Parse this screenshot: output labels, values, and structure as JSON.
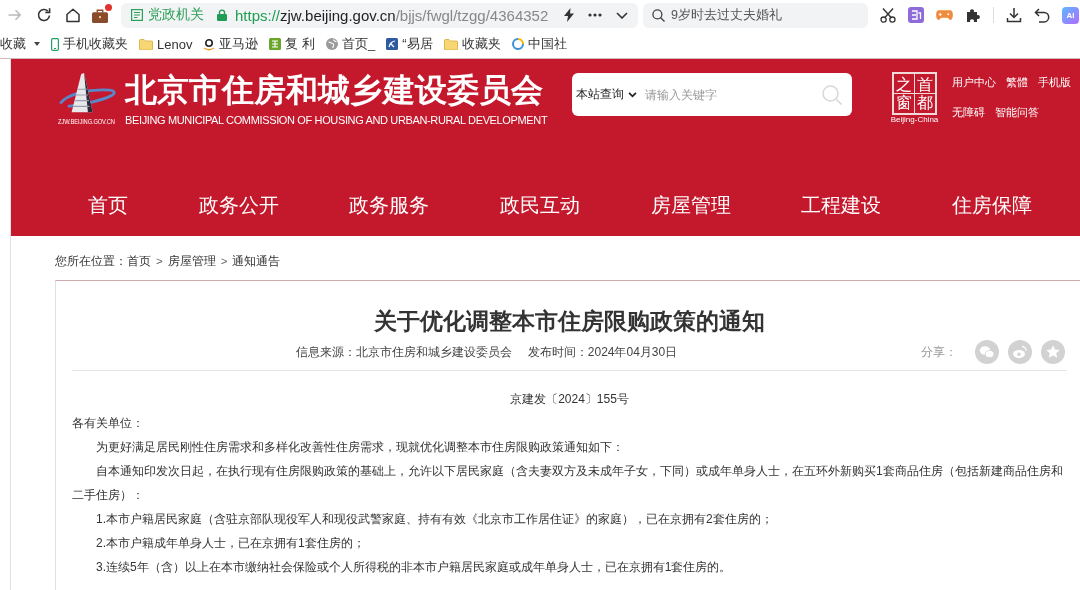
{
  "browser": {
    "nav_buttons": [
      {
        "kind": "forward",
        "disabled": true
      },
      {
        "kind": "reload",
        "disabled": false
      },
      {
        "kind": "home",
        "disabled": false
      }
    ],
    "extension_badge": true,
    "address_bar": {
      "badge": "党政机关",
      "secure": true,
      "url": {
        "scheme": "https://",
        "host": "zjw.beijing.gov.cn",
        "path": "/bjjs/fwgl/tzgg/4364352"
      }
    },
    "search": {
      "placeholder": "9岁时去过丈夫婚礼"
    },
    "ai_label": "AI"
  },
  "bookmarks": [
    {
      "kind": "menu",
      "label": "收藏"
    },
    {
      "kind": "phone",
      "label": "手机收藏夹"
    },
    {
      "kind": "folder",
      "label": "Lenov"
    },
    {
      "kind": "amazon",
      "label": "亚马逊"
    },
    {
      "kind": "green-tile",
      "label": "复 利"
    },
    {
      "kind": "globe",
      "label": "首页_"
    },
    {
      "kind": "blue-tile",
      "label": "“易居"
    },
    {
      "kind": "folder",
      "label": "收藏夹"
    },
    {
      "kind": "ring",
      "label": "中国社"
    }
  ],
  "site": {
    "logo_caption": "ZJW.BEIJING.GOV.CN",
    "title": "北京市住房和城乡建设委员会",
    "subtitle": "BEIJING MUNICIPAL COMMISSION OF HOUSING AND URBAN-RURAL DEVELOPMENT",
    "search": {
      "scope": "本站查询",
      "placeholder": "请输入关键字"
    },
    "capital_logo": {
      "columns": [
        "之窗",
        "首都"
      ],
      "caption": "Beijing-China"
    },
    "user_links": [
      [
        "用户中心",
        "繁體",
        "手机版"
      ],
      [
        "无障碍",
        "智能问答"
      ]
    ],
    "nav": [
      "首页",
      "政务公开",
      "政务服务",
      "政民互动",
      "房屋管理",
      "工程建设",
      "住房保障"
    ]
  },
  "breadcrumb": {
    "label": "您所在位置：",
    "items": [
      {
        "kind": "link",
        "text": "首页"
      },
      {
        "kind": "separator",
        "text": ">"
      },
      {
        "kind": "link",
        "text": "房屋管理"
      },
      {
        "kind": "separator",
        "text": ">"
      },
      {
        "kind": "link",
        "text": "通知通告"
      }
    ]
  },
  "article": {
    "title": "关于优化调整本市住房限购政策的通知",
    "source": "信息来源：北京市住房和城乡建设委员会",
    "date": "发布时间：2024年04月30日",
    "share_label": "分享：",
    "share": [
      {
        "kind": "chat"
      },
      {
        "kind": "swirl"
      },
      {
        "kind": "star"
      }
    ],
    "paragraphs": [
      {
        "kind": "doc_number",
        "text": "京建发〔2024〕155号"
      },
      {
        "kind": "salutation",
        "text": "各有关单位："
      },
      {
        "kind": "body",
        "text": "为更好满足居民刚性住房需求和多样化改善性住房需求，现就优化调整本市住房限购政策通知如下："
      },
      {
        "kind": "body",
        "text": "自本通知印发次日起，在执行现有住房限购政策的基础上，允许以下居民家庭（含夫妻双方及未成年子女，下同）或成年单身人士，在五环外新购买1套商品住房（包括新建商品住房和二手住房）："
      },
      {
        "kind": "body",
        "text": "1.本市户籍居民家庭（含驻京部队现役军人和现役武警家庭、持有有效《北京市工作居住证》的家庭），已在京拥有2套住房的；"
      },
      {
        "kind": "body",
        "text": "2.本市户籍成年单身人士，已在京拥有1套住房的；"
      },
      {
        "kind": "body",
        "text": "3.连续5年（含）以上在本市缴纳社会保险或个人所得税的非本市户籍居民家庭或成年单身人士，已在京拥有1套住房的。"
      }
    ]
  }
}
